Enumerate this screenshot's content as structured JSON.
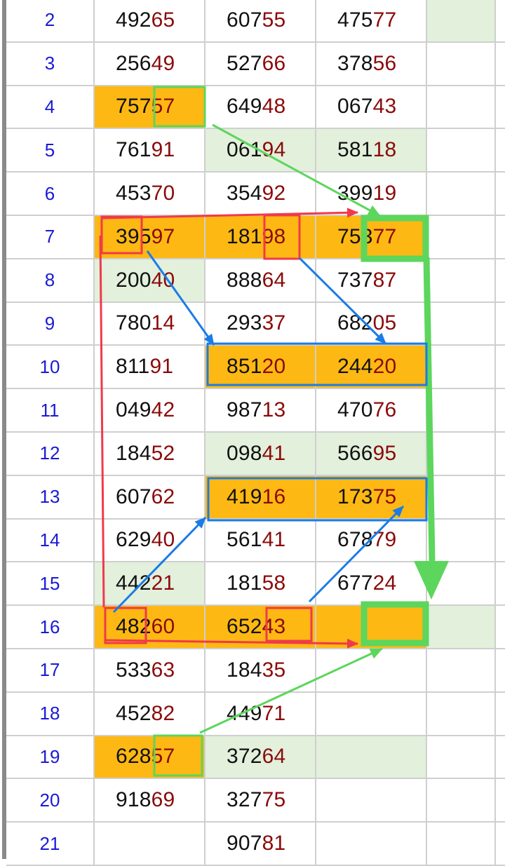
{
  "rows": [
    {
      "idx": "2",
      "cells": [
        {
          "a": "492",
          "b": "65"
        },
        {
          "a": "607",
          "b": "55"
        },
        {
          "a": "475",
          "b": "77"
        }
      ]
    },
    {
      "idx": "3",
      "cells": [
        {
          "a": "256",
          "b": "49"
        },
        {
          "a": "527",
          "b": "66"
        },
        {
          "a": "378",
          "b": "56"
        }
      ]
    },
    {
      "idx": "4",
      "cells": [
        {
          "a": "757",
          "b": "57"
        },
        {
          "a": "649",
          "b": "48"
        },
        {
          "a": "067",
          "b": "43"
        }
      ]
    },
    {
      "idx": "5",
      "cells": [
        {
          "a": "761",
          "b": "91"
        },
        {
          "a": "061",
          "b": "94"
        },
        {
          "a": "581",
          "b": "18"
        }
      ]
    },
    {
      "idx": "6",
      "cells": [
        {
          "a": "453",
          "b": "70"
        },
        {
          "a": "354",
          "b": "92"
        },
        {
          "a": "399",
          "b": "19"
        }
      ]
    },
    {
      "idx": "7",
      "cells": [
        {
          "a": "395",
          "b": "97"
        },
        {
          "a": "181",
          "b": "98"
        },
        {
          "a": "753",
          "b": "77"
        }
      ]
    },
    {
      "idx": "8",
      "cells": [
        {
          "a": "200",
          "b": "40"
        },
        {
          "a": "888",
          "b": "64"
        },
        {
          "a": "737",
          "b": "87"
        }
      ]
    },
    {
      "idx": "9",
      "cells": [
        {
          "a": "780",
          "b": "14"
        },
        {
          "a": "293",
          "b": "37"
        },
        {
          "a": "682",
          "b": "05"
        }
      ]
    },
    {
      "idx": "10",
      "cells": [
        {
          "a": "811",
          "b": "91"
        },
        {
          "a": "851",
          "b": "20"
        },
        {
          "a": "244",
          "b": "20"
        }
      ]
    },
    {
      "idx": "11",
      "cells": [
        {
          "a": "049",
          "b": "42"
        },
        {
          "a": "987",
          "b": "13"
        },
        {
          "a": "470",
          "b": "76"
        }
      ]
    },
    {
      "idx": "12",
      "cells": [
        {
          "a": "184",
          "b": "52"
        },
        {
          "a": "098",
          "b": "41"
        },
        {
          "a": "566",
          "b": "95"
        }
      ]
    },
    {
      "idx": "13",
      "cells": [
        {
          "a": "607",
          "b": "62"
        },
        {
          "a": "419",
          "b": "16"
        },
        {
          "a": "173",
          "b": "75"
        }
      ]
    },
    {
      "idx": "14",
      "cells": [
        {
          "a": "629",
          "b": "40"
        },
        {
          "a": "561",
          "b": "41"
        },
        {
          "a": "678",
          "b": "79"
        }
      ]
    },
    {
      "idx": "15",
      "cells": [
        {
          "a": "442",
          "b": "21"
        },
        {
          "a": "181",
          "b": "58"
        },
        {
          "a": "677",
          "b": "24"
        }
      ]
    },
    {
      "idx": "16",
      "cells": [
        {
          "a": "482",
          "b": "60"
        },
        {
          "a": "652",
          "b": "43"
        },
        {
          "a": "",
          "b": ""
        }
      ]
    },
    {
      "idx": "17",
      "cells": [
        {
          "a": "533",
          "b": "63"
        },
        {
          "a": "184",
          "b": "35"
        },
        {
          "a": "",
          "b": ""
        }
      ]
    },
    {
      "idx": "18",
      "cells": [
        {
          "a": "452",
          "b": "82"
        },
        {
          "a": "449",
          "b": "71"
        },
        {
          "a": "",
          "b": ""
        }
      ]
    },
    {
      "idx": "19",
      "cells": [
        {
          "a": "628",
          "b": "57"
        },
        {
          "a": "372",
          "b": "64"
        },
        {
          "a": "",
          "b": ""
        }
      ]
    },
    {
      "idx": "20",
      "cells": [
        {
          "a": "918",
          "b": "69"
        },
        {
          "a": "327",
          "b": "75"
        },
        {
          "a": "",
          "b": ""
        }
      ]
    },
    {
      "idx": "21",
      "cells": [
        {
          "a": "",
          "b": ""
        },
        {
          "a": "907",
          "b": "81"
        },
        {
          "a": "",
          "b": ""
        }
      ]
    }
  ],
  "highlight": {
    "orange": [
      [
        2,
        0
      ],
      [
        5,
        0
      ],
      [
        5,
        1
      ],
      [
        5,
        2
      ],
      [
        8,
        1
      ],
      [
        8,
        2
      ],
      [
        11,
        1
      ],
      [
        11,
        2
      ],
      [
        14,
        0
      ],
      [
        14,
        1
      ],
      [
        14,
        2
      ],
      [
        17,
        0
      ]
    ],
    "green": [
      [
        0,
        3
      ],
      [
        3,
        1
      ],
      [
        3,
        2
      ],
      [
        6,
        0
      ],
      [
        10,
        1
      ],
      [
        10,
        2
      ],
      [
        13,
        0
      ],
      [
        14,
        3
      ],
      [
        17,
        1
      ],
      [
        17,
        2
      ]
    ]
  },
  "colors": {
    "orange": "#fdb813",
    "green_fill": "#e2f0dc",
    "green_line": "#5cd65c",
    "red_line": "#f03a4a",
    "blue_line": "#1a7ce8",
    "index_text": "#1a1ad6",
    "digit_dark": "#111111",
    "digit_red": "#8b0a0a"
  }
}
